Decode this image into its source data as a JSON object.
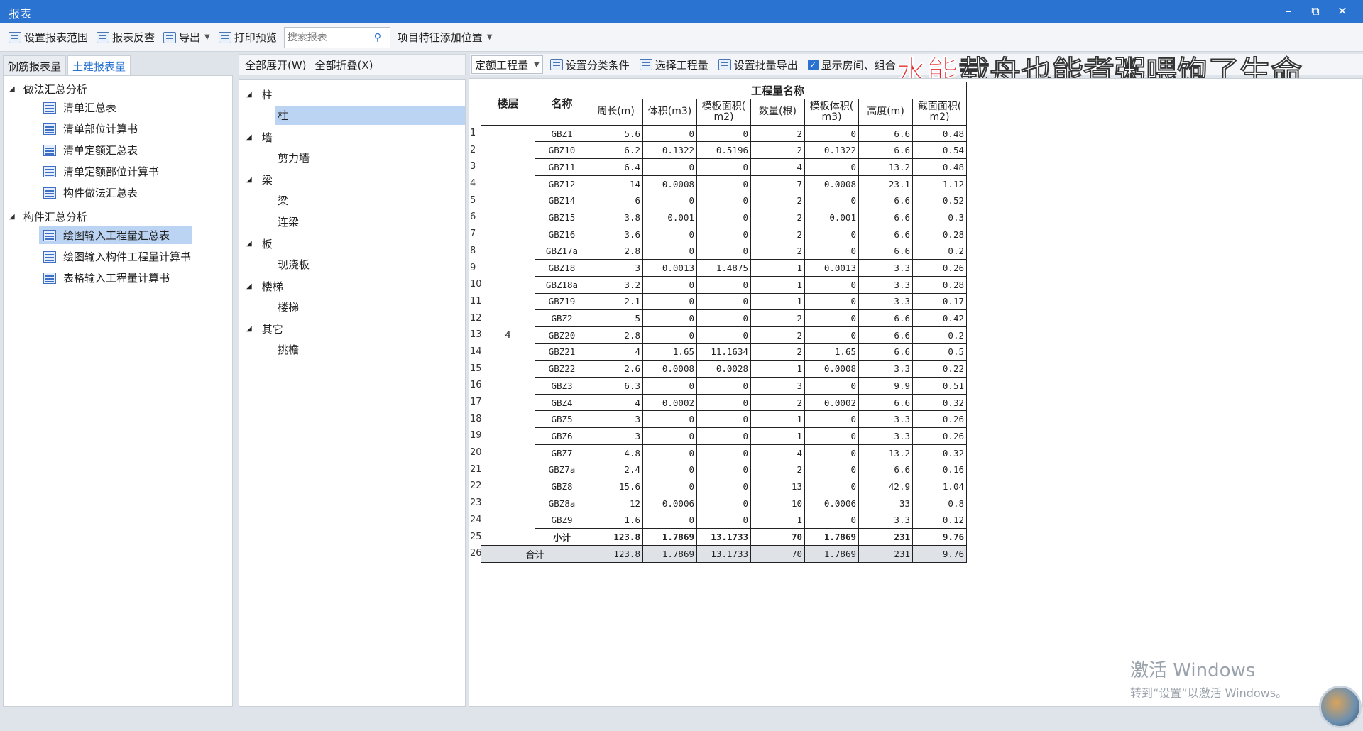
{
  "window": {
    "title": "报表",
    "minimize": "–",
    "restore": "⧉",
    "close": "✕"
  },
  "toolbar": {
    "set_range": "设置报表范围",
    "reverse_check": "报表反查",
    "export": "导出",
    "print_preview": "打印预览",
    "search_placeholder": "搜索报表",
    "add_position": "项目特征添加位置"
  },
  "left": {
    "tabs": [
      "钢筋报表量",
      "土建报表量"
    ],
    "groups": [
      {
        "label": "做法汇总分析",
        "items": [
          "清单汇总表",
          "清单部位计算书",
          "清单定额汇总表",
          "清单定额部位计算书",
          "构件做法汇总表"
        ]
      },
      {
        "label": "构件汇总分析",
        "items": [
          "绘图输入工程量汇总表",
          "绘图输入构件工程量计算书",
          "表格输入工程量计算书"
        ]
      }
    ]
  },
  "middle": {
    "expand_all": "全部展开(W)",
    "collapse_all": "全部折叠(X)",
    "categories": [
      {
        "label": "柱",
        "children": [
          "柱"
        ]
      },
      {
        "label": "墙",
        "children": [
          "剪力墙"
        ]
      },
      {
        "label": "梁",
        "children": [
          "梁",
          "连梁"
        ]
      },
      {
        "label": "板",
        "children": [
          "现浇板"
        ]
      },
      {
        "label": "楼梯",
        "children": [
          "楼梯"
        ]
      },
      {
        "label": "其它",
        "children": [
          "挑檐"
        ]
      }
    ]
  },
  "right_toolbar": {
    "quota_combo": "定额工程量",
    "set_category": "设置分类条件",
    "select_quantity": "选择工程量",
    "batch_export": "设置批量导出",
    "show_rooms": "显示房间、组合",
    "overlay_red": "水能",
    "overlay_rest": "载舟也能煮粥喂饱了生命"
  },
  "report": {
    "header": {
      "floor": "楼层",
      "name": "名称",
      "group": "工程量名称",
      "cols": [
        "周长(m)",
        "体积(m3)",
        "模板面积(\nm2)",
        "数量(根)",
        "模板体积(\nm3)",
        "高度(m)",
        "截面面积(\nm2)"
      ]
    },
    "floor_value": "4",
    "rows": [
      [
        "GBZ1",
        "5.6",
        "0",
        "0",
        "2",
        "0",
        "6.6",
        "0.48"
      ],
      [
        "GBZ10",
        "6.2",
        "0.1322",
        "0.5196",
        "2",
        "0.1322",
        "6.6",
        "0.54"
      ],
      [
        "GBZ11",
        "6.4",
        "0",
        "0",
        "4",
        "0",
        "13.2",
        "0.48"
      ],
      [
        "GBZ12",
        "14",
        "0.0008",
        "0",
        "7",
        "0.0008",
        "23.1",
        "1.12"
      ],
      [
        "GBZ14",
        "6",
        "0",
        "0",
        "2",
        "0",
        "6.6",
        "0.52"
      ],
      [
        "GBZ15",
        "3.8",
        "0.001",
        "0",
        "2",
        "0.001",
        "6.6",
        "0.3"
      ],
      [
        "GBZ16",
        "3.6",
        "0",
        "0",
        "2",
        "0",
        "6.6",
        "0.28"
      ],
      [
        "GBZ17a",
        "2.8",
        "0",
        "0",
        "2",
        "0",
        "6.6",
        "0.2"
      ],
      [
        "GBZ18",
        "3",
        "0.0013",
        "1.4875",
        "1",
        "0.0013",
        "3.3",
        "0.26"
      ],
      [
        "GBZ18a",
        "3.2",
        "0",
        "0",
        "1",
        "0",
        "3.3",
        "0.28"
      ],
      [
        "GBZ19",
        "2.1",
        "0",
        "0",
        "1",
        "0",
        "3.3",
        "0.17"
      ],
      [
        "GBZ2",
        "5",
        "0",
        "0",
        "2",
        "0",
        "6.6",
        "0.42"
      ],
      [
        "GBZ20",
        "2.8",
        "0",
        "0",
        "2",
        "0",
        "6.6",
        "0.2"
      ],
      [
        "GBZ21",
        "4",
        "1.65",
        "11.1634",
        "2",
        "1.65",
        "6.6",
        "0.5"
      ],
      [
        "GBZ22",
        "2.6",
        "0.0008",
        "0.0028",
        "1",
        "0.0008",
        "3.3",
        "0.22"
      ],
      [
        "GBZ3",
        "6.3",
        "0",
        "0",
        "3",
        "0",
        "9.9",
        "0.51"
      ],
      [
        "GBZ4",
        "4",
        "0.0002",
        "0",
        "2",
        "0.0002",
        "6.6",
        "0.32"
      ],
      [
        "GBZ5",
        "3",
        "0",
        "0",
        "1",
        "0",
        "3.3",
        "0.26"
      ],
      [
        "GBZ6",
        "3",
        "0",
        "0",
        "1",
        "0",
        "3.3",
        "0.26"
      ],
      [
        "GBZ7",
        "4.8",
        "0",
        "0",
        "4",
        "0",
        "13.2",
        "0.32"
      ],
      [
        "GBZ7a",
        "2.4",
        "0",
        "0",
        "2",
        "0",
        "6.6",
        "0.16"
      ],
      [
        "GBZ8",
        "15.6",
        "0",
        "0",
        "13",
        "0",
        "42.9",
        "1.04"
      ],
      [
        "GBZ8a",
        "12",
        "0.0006",
        "0",
        "10",
        "0.0006",
        "33",
        "0.8"
      ],
      [
        "GBZ9",
        "1.6",
        "0",
        "0",
        "1",
        "0",
        "3.3",
        "0.12"
      ]
    ],
    "subtotal": [
      "小计",
      "123.8",
      "1.7869",
      "13.1733",
      "70",
      "1.7869",
      "231",
      "9.76"
    ],
    "total": [
      "合计",
      "123.8",
      "1.7869",
      "13.1733",
      "70",
      "1.7869",
      "231",
      "9.76"
    ],
    "row_numbers": [
      "1",
      "2",
      "3",
      "4",
      "5",
      "6",
      "7",
      "8",
      "9",
      "10",
      "11",
      "12",
      "13",
      "14",
      "15",
      "16",
      "17",
      "18",
      "19",
      "20",
      "21",
      "22",
      "23",
      "24",
      "25",
      "26"
    ]
  },
  "watermark": {
    "line1": "激活 Windows",
    "line2": "转到“设置”以激活 Windows。"
  }
}
